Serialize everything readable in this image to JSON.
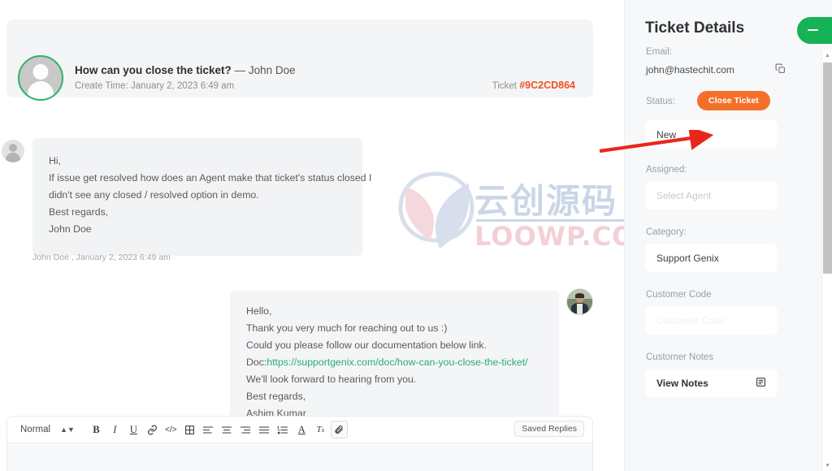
{
  "ticket_header": {
    "title": "How can you close the ticket?",
    "dash": "—",
    "requester": "John Doe",
    "create_time": "Create Time: January 2, 2023 6:49 am",
    "ticket_label": "Ticket",
    "ticket_id": "#9C2CD864",
    "avatar_icon": "user-silhouette-icon",
    "ring_color": "#2cb36a",
    "ticket_id_color": "#f4501e"
  },
  "conversation": {
    "customer_message": {
      "author": "John Doe",
      "avatar_icon": "user-silhouette-icon",
      "lines": [
        "Hi,",
        "If issue get resolved how does an Agent make that ticket's status closed I",
        "didn't see any closed / resolved option in demo.",
        "Best regards,",
        "John Doe"
      ],
      "meta": "John Doe , January 2, 2023 6:49 am"
    },
    "agent_message": {
      "author": "Ashim Kumar",
      "avatar_icon": "agent-photo-avatar",
      "line1": "Hello,",
      "line2": "Thank you very much for reaching out to us :)",
      "line3": "Could you please follow our documentation below link.",
      "line4_prefix": "Doc:",
      "line4_link": "https://supportgenix.com/doc/how-can-you-close-the-ticket/",
      "line5": "We'll look forward to hearing from you.",
      "line6": "Best regards,",
      "line7": "Ashim Kumar",
      "link_color": "#2aab72"
    }
  },
  "composer": {
    "format_select": "Normal",
    "saved_replies_label": "Saved Replies",
    "tools": [
      {
        "name": "bold-icon",
        "glyph": "B"
      },
      {
        "name": "italic-icon",
        "glyph": "I"
      },
      {
        "name": "underline-icon",
        "glyph": "U"
      },
      {
        "name": "link-icon",
        "glyph": "🔗"
      },
      {
        "name": "code-icon",
        "glyph": "</>"
      },
      {
        "name": "image-icon",
        "glyph": "▤"
      },
      {
        "name": "align-left-icon",
        "glyph": "≡"
      },
      {
        "name": "align-center-icon",
        "glyph": "≡"
      },
      {
        "name": "align-right-icon",
        "glyph": "≡"
      },
      {
        "name": "align-justify-icon",
        "glyph": "≡"
      },
      {
        "name": "ordered-list-icon",
        "glyph": "≣"
      },
      {
        "name": "text-color-icon",
        "glyph": "A"
      },
      {
        "name": "clear-format-icon",
        "glyph": "Tx"
      },
      {
        "name": "attachment-icon",
        "glyph": "📎"
      }
    ]
  },
  "watermark": {
    "cn_text": "云创源码",
    "en_text": "LOOWP.COM",
    "cn_color": "#7d9bc6",
    "en_color": "#e2899a"
  },
  "sidebar": {
    "title": "Ticket Details",
    "collapse_icon": "collapse-panel-icon",
    "collapse_color": "#16b256",
    "email": {
      "label": "Email:",
      "value": "john@hastechit.com",
      "copy_icon": "copy-icon"
    },
    "status": {
      "label": "Status:",
      "close_button": "Close Ticket",
      "close_button_color": "#f4702a",
      "value": "New"
    },
    "assigned": {
      "label": "Assigned:",
      "placeholder": "Select Agent"
    },
    "category": {
      "label": "Category:",
      "value": "Support Genix"
    },
    "customer_code": {
      "label": "Customer Code",
      "placeholder": "Customer Code"
    },
    "customer_notes": {
      "label": "Customer Notes",
      "value": "View Notes",
      "icon": "notes-icon"
    }
  },
  "annotation": {
    "arrow_color": "#e8271a",
    "points_to": "Close Ticket"
  }
}
